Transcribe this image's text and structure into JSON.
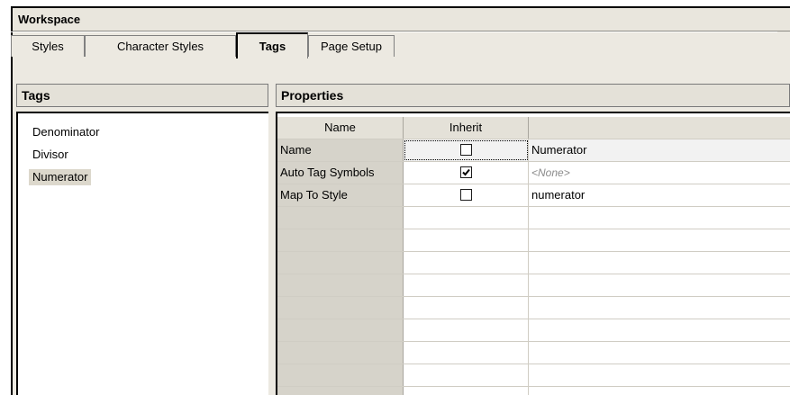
{
  "workspace": {
    "title": "Workspace"
  },
  "tabs": [
    {
      "label": "Styles",
      "active": false
    },
    {
      "label": "Character Styles",
      "active": false
    },
    {
      "label": "Tags",
      "active": true
    },
    {
      "label": "Page Setup",
      "active": false
    }
  ],
  "tags_panel": {
    "title": "Tags",
    "items": [
      "Denominator",
      "Divisor",
      "Numerator"
    ],
    "selected": "Numerator"
  },
  "properties_panel": {
    "title": "Properties",
    "columns": [
      "Name",
      "Inherit",
      ""
    ],
    "rows": [
      {
        "name": "Name",
        "inherit": false,
        "value": "Numerator"
      },
      {
        "name": "Auto Tag Symbols",
        "inherit": true,
        "value": "<None>"
      },
      {
        "name": "Map To Style",
        "inherit": false,
        "value": "numerator"
      }
    ]
  }
}
